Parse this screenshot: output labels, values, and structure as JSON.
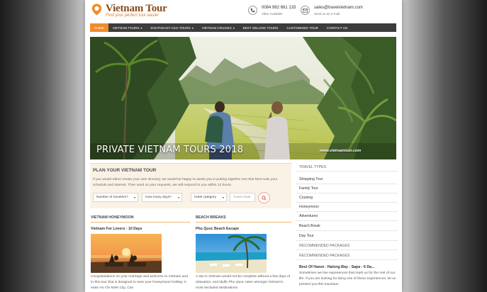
{
  "brand": {
    "name": "Vietnam Tour",
    "tagline": "Find your perfect tour easier"
  },
  "contacts": {
    "phone": {
      "value": "0084 982 661 133",
      "note": "Viber Available",
      "icon": "phone-icon"
    },
    "email": {
      "value": "sales@travelvietnam.com",
      "note": "Send us an e-mail",
      "icon": "envelope-icon"
    }
  },
  "nav": {
    "items": [
      {
        "label": "HOME",
        "active": true
      },
      {
        "label": "VIETNAM TOURS",
        "dropdown": true
      },
      {
        "label": "SOUTHEAST ASIA TOURS",
        "dropdown": true
      },
      {
        "label": "VIETNAM CRUISES",
        "dropdown": true
      },
      {
        "label": "BEST SELLING TOURS"
      },
      {
        "label": "CUSTOMIZED TOUR"
      },
      {
        "label": "CONTACT US"
      }
    ],
    "caret": "▾"
  },
  "hero": {
    "caption": "PRIVATE VIETNAM TOURS 2018",
    "watermark": "www.vietnamtour.com"
  },
  "plan": {
    "title": "PLAN YOUR VIETNAM TOUR",
    "description": "If you would rather create your own itinerary, we would be happy to assist you in putting together one that best suits your schedule and interest. Then send us your requests, we will respond to you within 12 hours.",
    "selects": {
      "travelers": "Number of travelers?",
      "days": "How many days?",
      "hotel": "Hotel category"
    },
    "date_placeholder": "Travel Date",
    "search_icon": "search-icon"
  },
  "columns": {
    "honeymoon": {
      "heading": "VIETNAM HONEYMOON",
      "post_title": "Vietnam For Lovers - 10 Days",
      "excerpt": "Congratulations on your marriage and welcome to Vietnam and to this tour that is designed to wow your honeymoon holiday. It visits Ho Chi Minh City, Can"
    },
    "beach": {
      "heading": "BEACH BREAKS",
      "post_title": "Phu Quoc Beach Escape",
      "excerpt": "A trip to Vietnam would not be complete without a few days of relaxation, and idyllic Phu Quoc rates amongst Vietnam's most secluded destinations."
    }
  },
  "sidebar": {
    "travel_types_heading": "TRAVEL TYPES",
    "travel_types": [
      "Shopping Tour",
      "Family Tour",
      "Cruising",
      "Honeymoon",
      "Adventures",
      "Beach Break",
      "Day Tour"
    ],
    "recommended_heading_1": "RECOMMENDED PACKAGES",
    "recommended_heading_2": "RECOMMENDED PACKAGES",
    "package_title": "Best Of Hanoi - Halong Bay - Sapa - 6 Da...",
    "package_text": "Sometimes we live experiences that mark us for the rest of our life. If you are looking for living one of these experiences, let us present you this luxurious"
  },
  "colors": {
    "accent": "#f28a2b",
    "nav_bg": "#3c3c3c",
    "plan_bg": "#fbf2e6"
  }
}
